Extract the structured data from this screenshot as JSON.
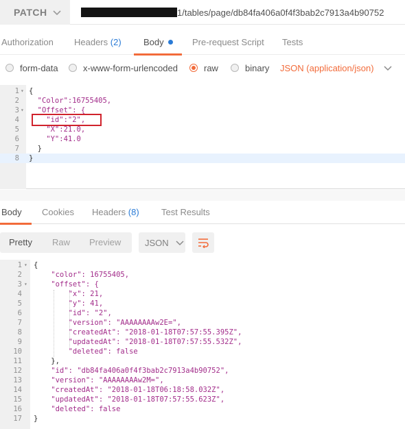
{
  "request": {
    "method": "PATCH",
    "url_visible": "1/tables/page/db84fa406a0f4f3bab2c7913a4b90752"
  },
  "request_tabs": [
    {
      "label": "Authorization"
    },
    {
      "label": "Headers",
      "count": "(2)"
    },
    {
      "label": "Body",
      "active": true
    },
    {
      "label": "Pre-request Script"
    },
    {
      "label": "Tests"
    }
  ],
  "body_types": {
    "options": [
      "form-data",
      "x-www-form-urlencoded",
      "raw",
      "binary"
    ],
    "selected": "raw",
    "content_type": "JSON (application/json)"
  },
  "request_body": {
    "lines": [
      {
        "n": "1",
        "fold": "▾",
        "text": "{"
      },
      {
        "n": "2",
        "text": "  \"Color\":16755405,"
      },
      {
        "n": "3",
        "fold": "▾",
        "text": "  \"Offset\": {"
      },
      {
        "n": "4",
        "text": "    \"id\":\"2\","
      },
      {
        "n": "5",
        "text": "    \"X\":21.0,"
      },
      {
        "n": "6",
        "text": "    \"Y\":41.0"
      },
      {
        "n": "7",
        "text": "  }"
      },
      {
        "n": "8",
        "text": "}"
      }
    ]
  },
  "response_tabs": [
    {
      "label": "Body",
      "active": true
    },
    {
      "label": "Cookies"
    },
    {
      "label": "Headers",
      "count": "(8)"
    },
    {
      "label": "Test Results"
    }
  ],
  "response_toolbar": {
    "views": [
      "Pretty",
      "Raw",
      "Preview"
    ],
    "active_view": "Pretty",
    "format": "JSON"
  },
  "response_body": {
    "lines": [
      {
        "n": "1",
        "fold": "▾",
        "text": "{"
      },
      {
        "n": "2",
        "text": "    \"color\": 16755405,"
      },
      {
        "n": "3",
        "fold": "▾",
        "text": "    \"offset\": {"
      },
      {
        "n": "4",
        "text": "        \"x\": 21,"
      },
      {
        "n": "5",
        "text": "        \"y\": 41,"
      },
      {
        "n": "6",
        "text": "        \"id\": \"2\","
      },
      {
        "n": "7",
        "text": "        \"version\": \"AAAAAAAAw2E=\","
      },
      {
        "n": "8",
        "text": "        \"createdAt\": \"2018-01-18T07:57:55.395Z\","
      },
      {
        "n": "9",
        "text": "        \"updatedAt\": \"2018-01-18T07:57:55.532Z\","
      },
      {
        "n": "10",
        "text": "        \"deleted\": false"
      },
      {
        "n": "11",
        "text": "    },"
      },
      {
        "n": "12",
        "text": "    \"id\": \"db84fa406a0f4f3bab2c7913a4b90752\","
      },
      {
        "n": "13",
        "text": "    \"version\": \"AAAAAAAAw2M=\","
      },
      {
        "n": "14",
        "text": "    \"createdAt\": \"2018-01-18T06:18:58.032Z\","
      },
      {
        "n": "15",
        "text": "    \"updatedAt\": \"2018-01-18T07:57:55.623Z\","
      },
      {
        "n": "16",
        "text": "    \"deleted\": false"
      },
      {
        "n": "17",
        "text": "}"
      }
    ]
  },
  "colors": {
    "accent": "#f26b3a",
    "link_blue": "#2a7bd6",
    "string": "#a22c8a",
    "highlight_box": "#d0222c"
  }
}
